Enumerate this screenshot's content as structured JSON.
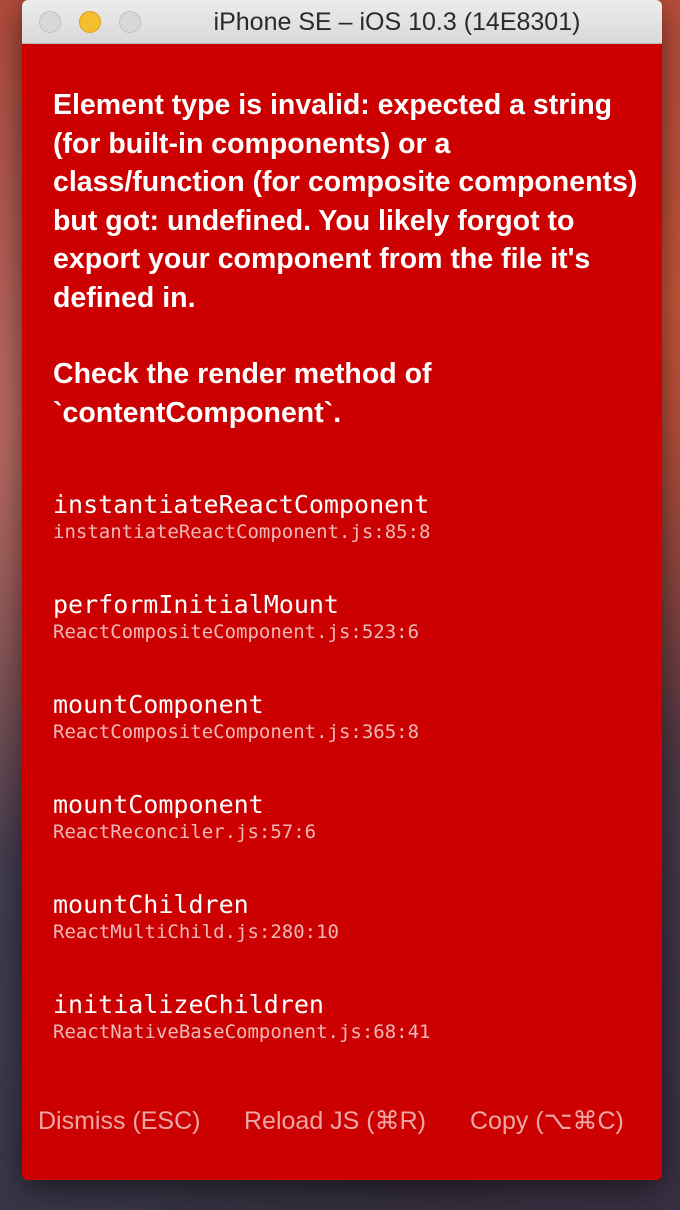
{
  "window": {
    "title": "iPhone SE – iOS 10.3 (14E8301)"
  },
  "error": {
    "message": "Element type is invalid: expected a string (for built-in components) or a class/function (for composite components) but got: undefined. You likely forgot to export your component from the file it's defined in.",
    "hint": "Check the render method of `contentComponent`."
  },
  "stack": [
    {
      "method": "instantiateReactComponent",
      "file": "instantiateReactComponent.js:85:8"
    },
    {
      "method": "performInitialMount",
      "file": "ReactCompositeComponent.js:523:6"
    },
    {
      "method": "mountComponent",
      "file": "ReactCompositeComponent.js:365:8"
    },
    {
      "method": "mountComponent",
      "file": "ReactReconciler.js:57:6"
    },
    {
      "method": "mountChildren",
      "file": "ReactMultiChild.js:280:10"
    },
    {
      "method": "initializeChildren",
      "file": "ReactNativeBaseComponent.js:68:41"
    }
  ],
  "buttons": {
    "dismiss": "Dismiss (ESC)",
    "reload": "Reload JS (⌘R)",
    "copy": "Copy (⌥⌘C)"
  },
  "colors": {
    "redbox_background": "#cc0000",
    "text": "#ffffff",
    "minimize_button": "#f5be2f"
  }
}
